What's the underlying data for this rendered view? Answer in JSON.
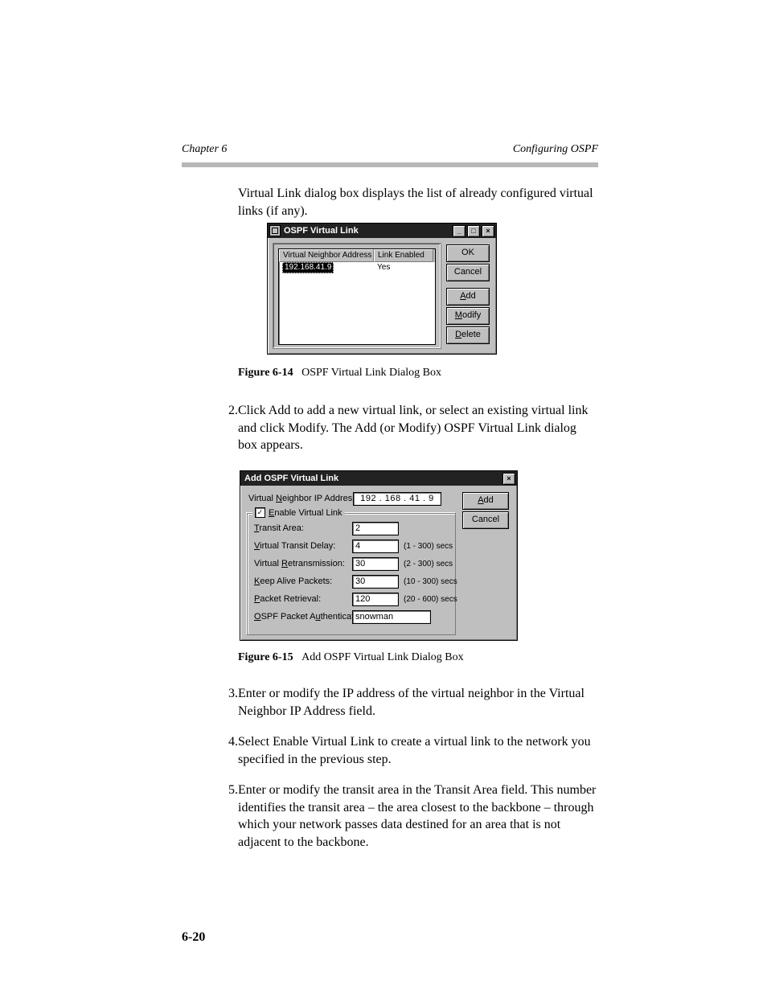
{
  "header": {
    "left": "Chapter 6",
    "right": "Configuring OSPF"
  },
  "intro": "Virtual Link dialog box displays the list of already configured virtual links (if any).",
  "fig1_caption_label": "Figure 6-14",
  "fig1_caption_text": "OSPF Virtual Link Dialog Box",
  "step2": {
    "num": "2.",
    "text": "Click Add to add a new virtual link, or select an existing virtual link and click Modify. The Add (or Modify) OSPF Virtual Link dialog box appears."
  },
  "fig2_caption_label": "Figure 6-15",
  "fig2_caption_text": "Add OSPF Virtual Link Dialog Box",
  "step3": {
    "num": "3.",
    "text": "Enter or modify the IP address of the virtual neighbor in the Virtual Neighbor IP Address field."
  },
  "step4": {
    "num": "4.",
    "text": "Select Enable Virtual Link to create a virtual link to the network you specified in the previous step."
  },
  "step5": {
    "num": "5.",
    "text": "Enter or modify the transit area in the Transit Area field. This number identifies the transit area – the area closest to the backbone – through which your network passes data destined for an area that is not adjacent to the backbone."
  },
  "footer_page": "6-20",
  "dlg1": {
    "title": "OSPF Virtual Link",
    "columns": [
      "Virtual Neighbor Address",
      "Link Enabled"
    ],
    "row": {
      "addr": "192.168.41.9",
      "enabled": "Yes"
    },
    "buttons": {
      "ok": "OK",
      "cancel": "Cancel",
      "add": "Add",
      "modify": "Modify",
      "delete": "Delete"
    }
  },
  "dlg2": {
    "title": "Add OSPF Virtual Link",
    "labels": {
      "ip": "Virtual Neighbor IP Address:",
      "enable": "Enable Virtual Link",
      "transit": "Transit Area:",
      "delay": "Virtual Transit Delay:",
      "retrans": "Virtual Retransmission:",
      "keep": "Keep Alive Packets:",
      "retrieve": "Packet Retrieval:",
      "auth": "OSPF Packet Authentication Key:"
    },
    "values": {
      "ip": "192 . 168 .  41  .   9",
      "transit": "2",
      "delay": "4",
      "retrans": "30",
      "keep": "30",
      "retrieve": "120",
      "auth": "snowman"
    },
    "units": {
      "delay": "(1 - 300) secs",
      "retrans": "(2 - 300) secs",
      "keep": "(10 - 300) secs",
      "retrieve": "(20 - 600) secs"
    },
    "buttons": {
      "add": "Add",
      "cancel": "Cancel"
    }
  }
}
